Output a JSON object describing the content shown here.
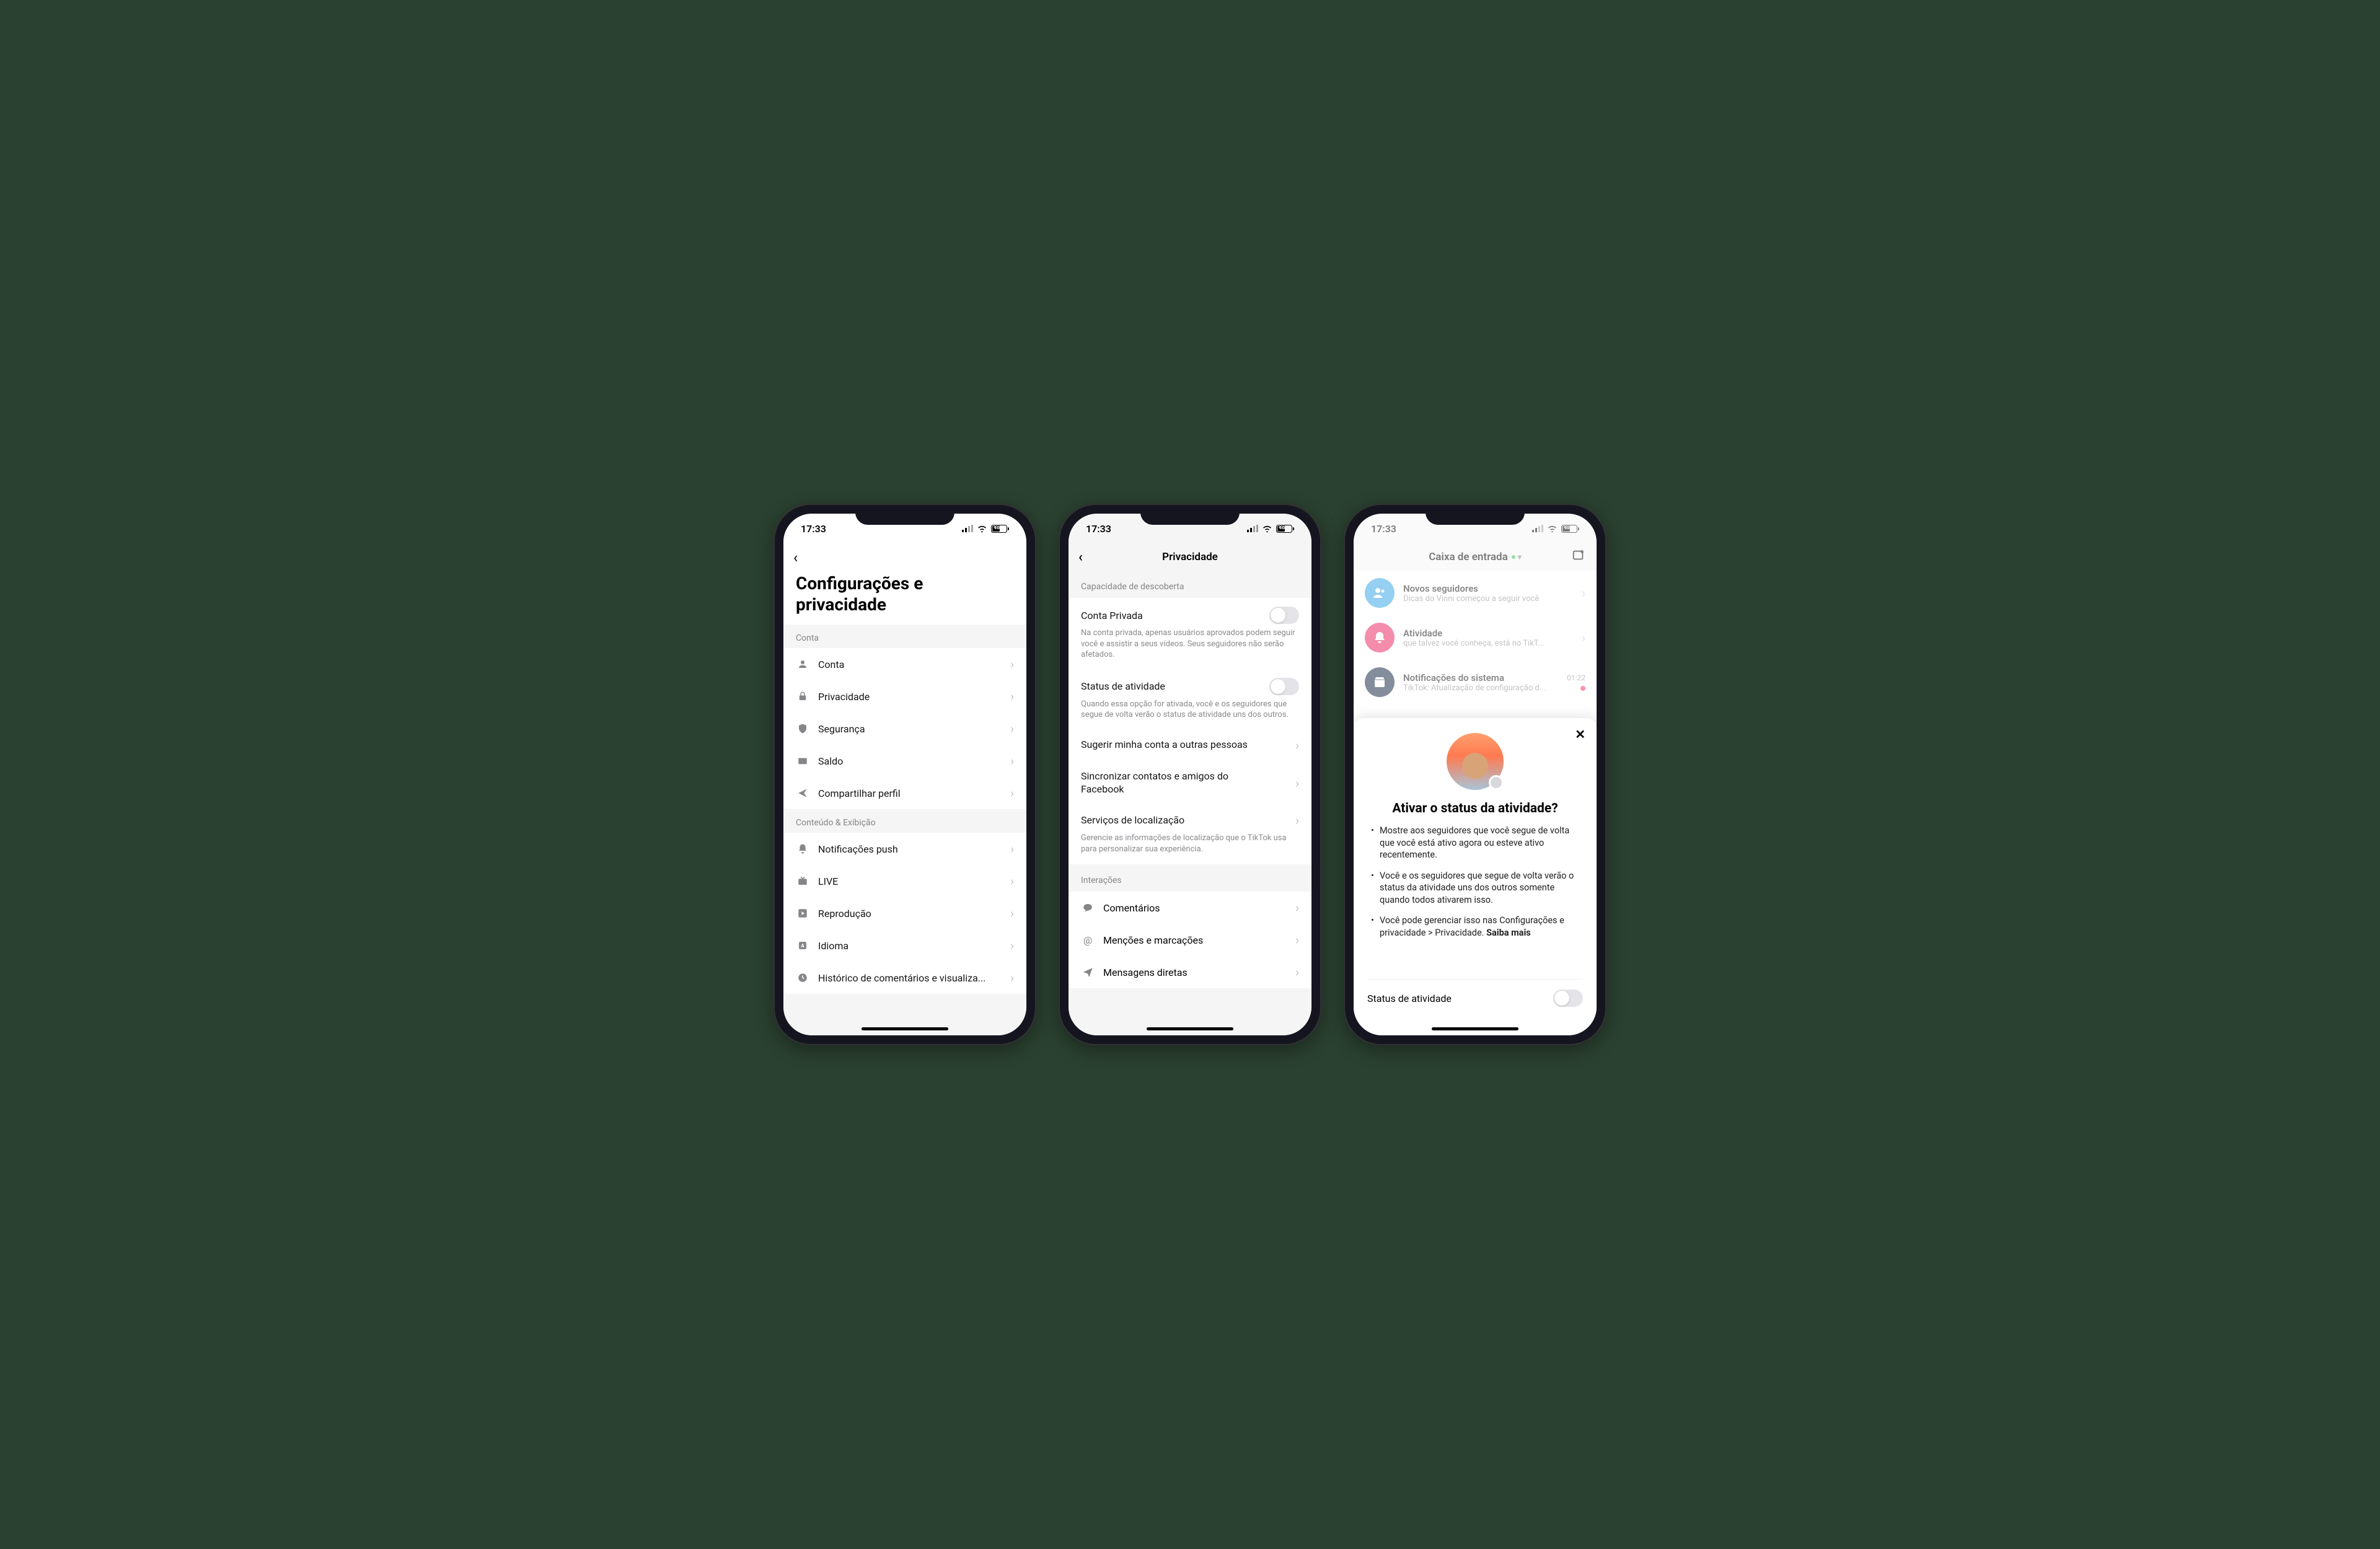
{
  "status": {
    "time": "17:33",
    "battery": "48"
  },
  "phone1": {
    "title": "Configurações e privacidade",
    "sections": [
      {
        "header": "Conta",
        "items": [
          {
            "icon": "person",
            "label": "Conta"
          },
          {
            "icon": "lock",
            "label": "Privacidade"
          },
          {
            "icon": "shield",
            "label": "Segurança"
          },
          {
            "icon": "wallet",
            "label": "Saldo"
          },
          {
            "icon": "share",
            "label": "Compartilhar perfil"
          }
        ]
      },
      {
        "header": "Conteúdo & Exibição",
        "items": [
          {
            "icon": "bell",
            "label": "Notificações push"
          },
          {
            "icon": "tv",
            "label": "LIVE"
          },
          {
            "icon": "play",
            "label": "Reprodução"
          },
          {
            "icon": "lang",
            "label": "Idioma"
          },
          {
            "icon": "clock",
            "label": "Histórico de comentários e visualiza..."
          }
        ]
      }
    ]
  },
  "phone2": {
    "title": "Privacidade",
    "discover_header": "Capacidade de descoberta",
    "private": {
      "label": "Conta Privada",
      "desc": "Na conta privada, apenas usuários aprovados podem seguir você e assistir a seus vídeos. Seus seguidores não serão afetados."
    },
    "activity": {
      "label": "Status de atividade",
      "desc": "Quando essa opção for ativada, você e os seguidores que segue de volta verão o status de atividade uns dos outros."
    },
    "suggest": "Sugerir minha conta a outras pessoas",
    "sync": "Sincronizar contatos e amigos do Facebook",
    "location": "Serviços de localização",
    "location_desc": "Gerencie as informações de localização que o TikTok usa para personalizar sua experiência.",
    "interactions_header": "Interações",
    "interactions": [
      {
        "icon": "comment",
        "label": "Comentários"
      },
      {
        "icon": "at",
        "label": "Menções e marcações"
      },
      {
        "icon": "send",
        "label": "Mensagens diretas"
      }
    ]
  },
  "phone3": {
    "inbox_title": "Caixa de entrada",
    "rows": [
      {
        "color": "#2ea0e6",
        "icon": "followers",
        "title": "Novos seguidores",
        "sub": "Dicas do Vinni começou a seguir você",
        "chevron": true
      },
      {
        "color": "#e91e5a",
        "icon": "bell",
        "title": "Atividade",
        "sub": "que talvez você conheça, está no TikT...",
        "chevron": true
      },
      {
        "color": "#0a1e3c",
        "icon": "inbox",
        "title": "Notificações do sistema",
        "sub": "TikTok: Atualização de configuração d...",
        "time": "01:22",
        "dot": true
      }
    ],
    "sheet": {
      "title": "Ativar o status da atividade?",
      "bullets": [
        "Mostre aos seguidores que você segue de volta que você está ativo agora ou esteve ativo recentemente.",
        "Você e os seguidores que segue de volta verão o status da atividade uns dos outros somente quando todos ativarem isso.",
        "Você pode gerenciar isso nas Configurações e privacidade > Privacidade. "
      ],
      "learn_more": "Saiba mais",
      "toggle_label": "Status de atividade"
    }
  }
}
